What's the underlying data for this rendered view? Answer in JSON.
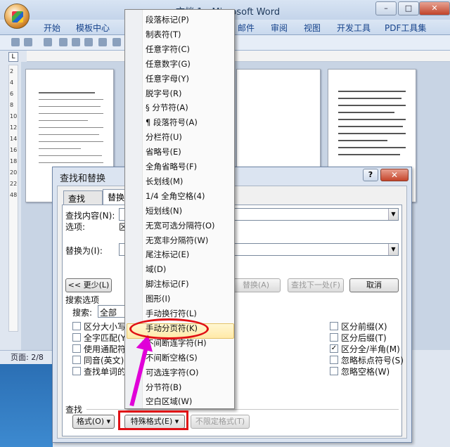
{
  "window": {
    "title": "文档 1 - Microsoft Word",
    "controls": [
      "–",
      "□",
      "✕"
    ]
  },
  "ribbon": {
    "tabs": [
      "开始",
      "模板中心",
      "邮件",
      "审阅",
      "视图",
      "开发工具",
      "PDF工具集"
    ]
  },
  "ruler": {
    "corner": "L",
    "marks": [
      "2",
      "4",
      "6",
      "8",
      "10",
      "12",
      "14",
      "16",
      "18",
      "20",
      "22",
      "24",
      "26",
      "28",
      "30",
      "32",
      "34",
      "36",
      "38",
      "40",
      "42",
      "44",
      "46",
      "48"
    ]
  },
  "status": {
    "page": "页面: 2/8"
  },
  "dialog": {
    "title": "查找和替换",
    "help": "?",
    "close": "✕",
    "tabs": {
      "find": "查找(D)",
      "replace": "替换(P)"
    },
    "find_label": "查找内容(N):",
    "options_label": "选项:",
    "options_value": "区",
    "replace_label": "替换为(I):",
    "less_button": "<< 更少(L)",
    "replace_button": "替换(A)",
    "find_next_button": "查找下一处(F)",
    "cancel_button": "取消",
    "search_options": "搜索选项",
    "search_label": "搜索:",
    "search_value": "全部",
    "left_checks": [
      {
        "label": "区分大小写",
        "checked": false
      },
      {
        "label": "全字匹配(Y)",
        "checked": false
      },
      {
        "label": "使用通配符",
        "checked": false
      },
      {
        "label": "同音(英文)",
        "checked": false
      },
      {
        "label": "查找单词的所",
        "checked": false
      }
    ],
    "right_checks": [
      {
        "label": "区分前缀(X)",
        "checked": false
      },
      {
        "label": "区分后缀(T)",
        "checked": false
      },
      {
        "label": "区分全/半角(M)",
        "checked": true
      },
      {
        "label": "忽略标点符号(S)",
        "checked": false
      },
      {
        "label": "忽略空格(W)",
        "checked": false
      }
    ],
    "find_section": "查找",
    "format_button": "格式(O) ▾",
    "special_button": "特殊格式(E) ▾",
    "no_format_button": "不限定格式(T)"
  },
  "special_menu": {
    "items": [
      "段落标记(P)",
      "制表符(T)",
      "任意字符(C)",
      "任意数字(G)",
      "任意字母(Y)",
      "脱字号(R)",
      "§ 分节符(A)",
      "¶ 段落符号(A)",
      "分栏符(U)",
      "省略号(E)",
      "全角省略号(F)",
      "长划线(M)",
      "1/4 全角空格(4)",
      "短划线(N)",
      "无宽可选分隔符(O)",
      "无宽非分隔符(W)",
      "尾注标记(E)",
      "域(D)",
      "脚注标记(F)",
      "图形(I)",
      "手动换行符(L)",
      "手动分页符(K)",
      "不间断连字符(H)",
      "不间断空格(S)",
      "可选连字符(O)",
      "分节符(B)",
      "空白区域(W)"
    ],
    "highlighted_index": 21
  },
  "colors": {
    "annotation_red": "#e01015",
    "annotation_arrow": "#e000d8",
    "highlight": "#ffe9a8"
  }
}
